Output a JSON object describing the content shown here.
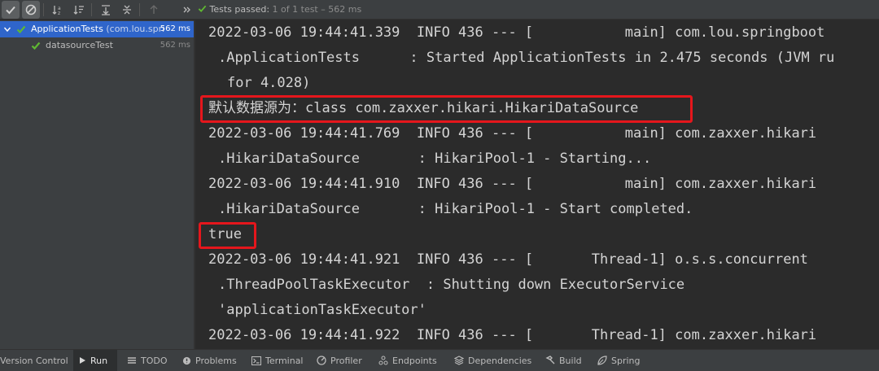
{
  "toolbar": {
    "status_main": "Tests passed:",
    "status_count": "1",
    "status_rest": "of 1 test – 562 ms",
    "icons": [
      "passed-filter-icon",
      "ignored-filter-icon",
      "sort-alpha-icon",
      "sort-duration-icon",
      "expand-all-icon",
      "collapse-all-icon",
      "previous-failed-icon",
      "more-icon"
    ],
    "accent_color": "#5fb832"
  },
  "tree": {
    "items": [
      {
        "label": "ApplicationTests",
        "pkg": "(com.lou.spri",
        "duration": "562 ms",
        "status": "passed"
      },
      {
        "label": "datasourceTest",
        "pkg": "",
        "duration": "562 ms",
        "status": "passed"
      }
    ]
  },
  "console": {
    "lines": [
      "2022-03-06 19:44:41.339  INFO 436 --- [           main] com.lou.springboot",
      ".ApplicationTests      : Started ApplicationTests in 2.475 seconds (JVM ru",
      "for 4.028)",
      "默认数据源为：class com.zaxxer.hikari.HikariDataSource",
      "2022-03-06 19:44:41.769  INFO 436 --- [           main] com.zaxxer.hikari",
      ".HikariDataSource       : HikariPool-1 - Starting...",
      "2022-03-06 19:44:41.910  INFO 436 --- [           main] com.zaxxer.hikari",
      ".HikariDataSource       : HikariPool-1 - Start completed.",
      "true",
      "2022-03-06 19:44:41.921  INFO 436 --- [       Thread-1] o.s.s.concurrent",
      ".ThreadPoolTaskExecutor  : Shutting down ExecutorService",
      "'applicationTaskExecutor'",
      "2022-03-06 19:44:41.922  INFO 436 --- [       Thread-1] com.zaxxer.hikari"
    ],
    "highlight_color": "#e5161c"
  },
  "bottombar": {
    "items": [
      {
        "label": "Version Control",
        "icon": "vcs-icon"
      },
      {
        "label": "Run",
        "icon": "run-icon",
        "active": true
      },
      {
        "label": "TODO",
        "icon": "todo-icon"
      },
      {
        "label": "Problems",
        "icon": "problems-icon"
      },
      {
        "label": "Terminal",
        "icon": "terminal-icon"
      },
      {
        "label": "Profiler",
        "icon": "profiler-icon"
      },
      {
        "label": "Endpoints",
        "icon": "endpoints-icon"
      },
      {
        "label": "Dependencies",
        "icon": "dependencies-icon"
      },
      {
        "label": "Build",
        "icon": "build-icon"
      },
      {
        "label": "Spring",
        "icon": "spring-icon"
      }
    ]
  }
}
